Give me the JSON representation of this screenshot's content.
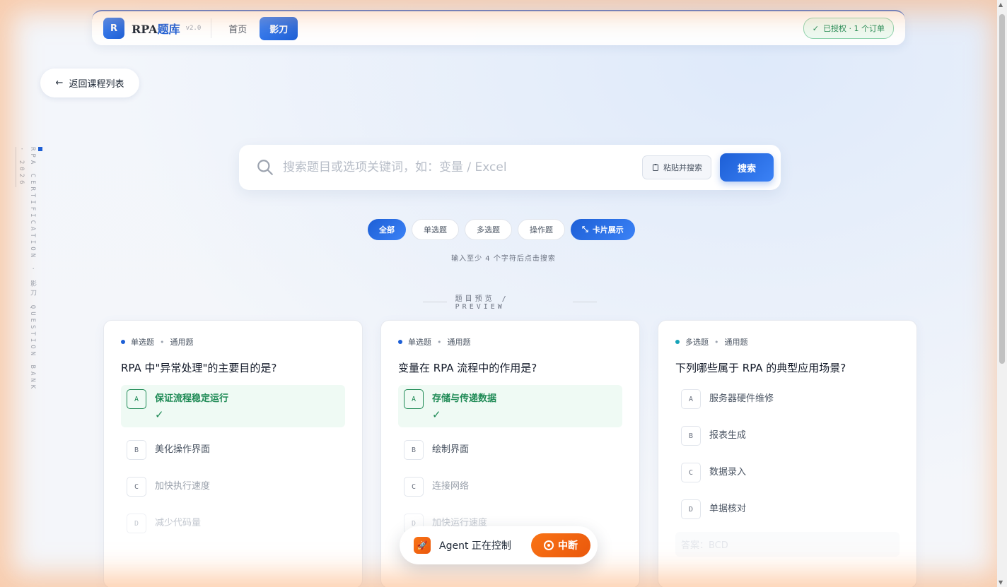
{
  "nav": {
    "logo_letter": "R",
    "brand_main": "RPA",
    "brand_accent": "题库",
    "version": "v2.0",
    "links": [
      {
        "label": "首页"
      },
      {
        "label": "影刀"
      }
    ],
    "license": "已授权 · 1 个订单"
  },
  "back": {
    "label": "返回课程列表"
  },
  "side": {
    "vertical_text": "RPA CERTIFICATION · 影刀 QUESTION BANK",
    "year": "· 2026"
  },
  "search": {
    "placeholder": "搜索题目或选项关键词，如：变量 / Excel",
    "paste_label": "粘贴并搜索",
    "button_label": "搜索"
  },
  "filters": {
    "all": "全部",
    "single": "单选题",
    "multi": "多选题",
    "operation": "操作题",
    "card_view": "卡片展示"
  },
  "hint": "输入至少 4 个字符后点击搜索",
  "preview_title": "题目预览 / PREVIEW",
  "cards": [
    {
      "type": "单选题",
      "category": "通用题",
      "question": "RPA 中\"异常处理\"的主要目的是?",
      "options": [
        {
          "key": "A",
          "text": "保证流程稳定运行"
        },
        {
          "key": "B",
          "text": "美化操作界面"
        },
        {
          "key": "C",
          "text": "加快执行速度"
        },
        {
          "key": "D",
          "text": "减少代码量"
        }
      ],
      "check": "✓"
    },
    {
      "type": "单选题",
      "category": "通用题",
      "question": "变量在 RPA 流程中的作用是?",
      "options": [
        {
          "key": "A",
          "text": "存储与传递数据"
        },
        {
          "key": "B",
          "text": "绘制界面"
        },
        {
          "key": "C",
          "text": "连接网络"
        },
        {
          "key": "D",
          "text": "加快运行速度"
        }
      ],
      "check": "✓"
    },
    {
      "type": "多选题",
      "category": "通用题",
      "question": "下列哪些属于 RPA 的典型应用场景?",
      "options": [
        {
          "key": "A",
          "text": "服务器硬件维修"
        },
        {
          "key": "B",
          "text": "报表生成"
        },
        {
          "key": "C",
          "text": "数据录入"
        },
        {
          "key": "D",
          "text": "单据核对"
        }
      ],
      "answer": "答案：BCD"
    }
  ],
  "agent": {
    "status": "Agent 正在控制",
    "stop_label": "中断"
  },
  "colors": {
    "accent": "#1d5fd6",
    "success": "#1e8a55",
    "agent": "#f97316"
  }
}
